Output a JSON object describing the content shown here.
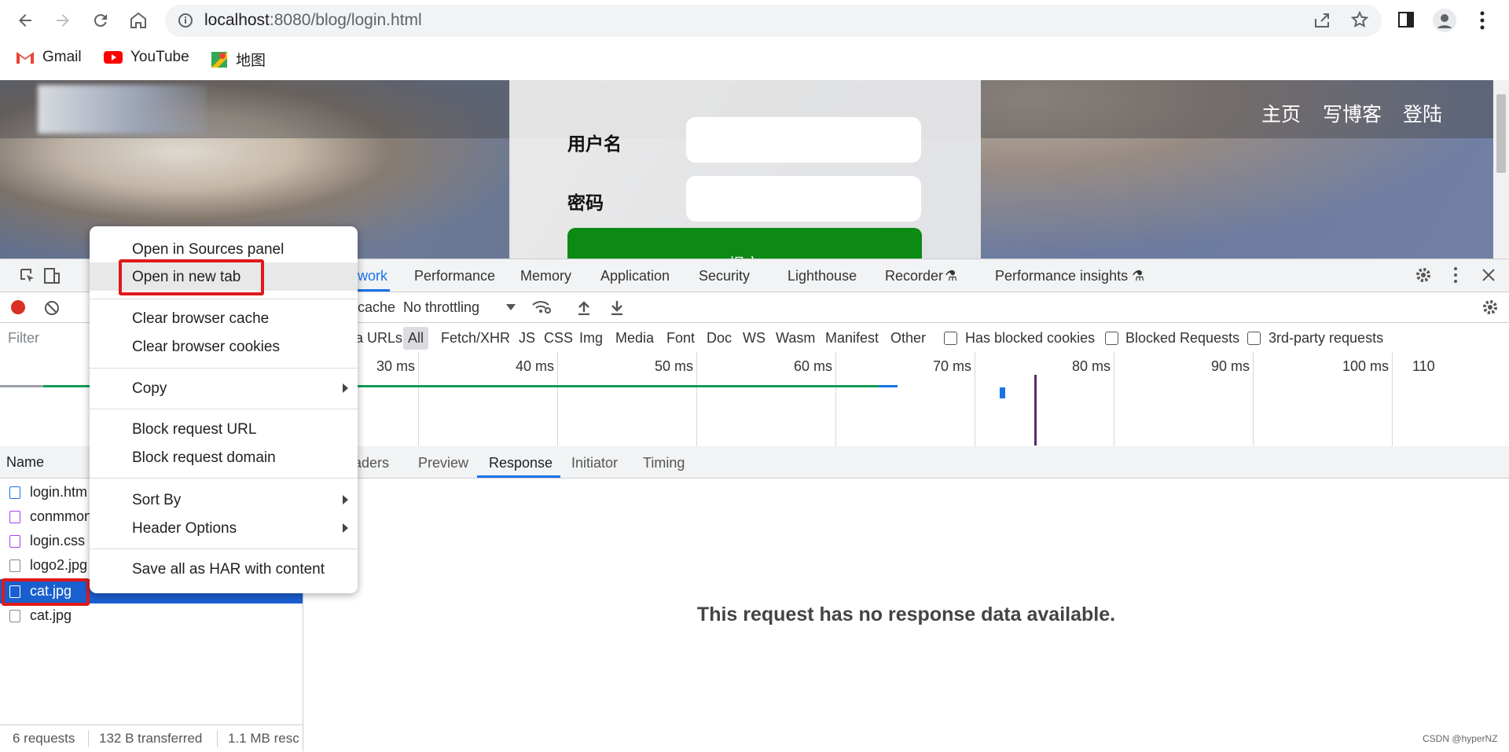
{
  "browser": {
    "url_host": "localhost",
    "url_path": ":8080/blog/login.html",
    "bookmarks": [
      {
        "label": "Gmail",
        "icon": "gmail-icon"
      },
      {
        "label": "YouTube",
        "icon": "youtube-icon"
      },
      {
        "label": "地图",
        "icon": "maps-icon"
      }
    ]
  },
  "page": {
    "nav": [
      "主页",
      "写博客",
      "登陆"
    ],
    "username_label": "用户名",
    "password_label": "密码",
    "submit_label": "提交"
  },
  "devtools": {
    "tabs": [
      "work",
      "Performance",
      "Memory",
      "Application",
      "Security",
      "Lighthouse",
      "Recorder",
      "Performance insights"
    ],
    "toolbar": {
      "cache_text": "cache",
      "throttling": "No throttling"
    },
    "filter_placeholder": "Filter",
    "filter_types": [
      "a URLs",
      "All",
      "Fetch/XHR",
      "JS",
      "CSS",
      "Img",
      "Media",
      "Font",
      "Doc",
      "WS",
      "Wasm",
      "Manifest",
      "Other"
    ],
    "checkboxes": [
      "Has blocked cookies",
      "Blocked Requests",
      "3rd-party requests"
    ],
    "timeline_ticks": [
      "30 ms",
      "40 ms",
      "50 ms",
      "60 ms",
      "70 ms",
      "80 ms",
      "90 ms",
      "100 ms",
      "110"
    ],
    "name_header": "Name",
    "requests": [
      {
        "name": "login.htm",
        "type": "doc"
      },
      {
        "name": "conmmon",
        "type": "css"
      },
      {
        "name": "login.css",
        "type": "css"
      },
      {
        "name": "logo2.jpg",
        "type": "img"
      },
      {
        "name": "cat.jpg",
        "type": "img",
        "selected": true
      },
      {
        "name": "cat.jpg",
        "type": "img"
      }
    ],
    "detail_tabs": [
      "eaders",
      "Preview",
      "Response",
      "Initiator",
      "Timing"
    ],
    "active_detail_tab": "Response",
    "no_response_message": "This request has no response data available.",
    "status": {
      "requests": "6 requests",
      "transferred": "132 B transferred",
      "resources": "1.1 MB resc"
    }
  },
  "context_menu": {
    "items": [
      {
        "label": "Open in Sources panel"
      },
      {
        "label": "Open in new tab",
        "highlighted": true
      },
      {
        "label": "Clear browser cache"
      },
      {
        "label": "Clear browser cookies"
      },
      {
        "label": "Copy",
        "submenu": true
      },
      {
        "label": "Block request URL"
      },
      {
        "label": "Block request domain"
      },
      {
        "label": "Sort By",
        "submenu": true
      },
      {
        "label": "Header Options",
        "submenu": true
      },
      {
        "label": "Save all as HAR with content"
      }
    ]
  },
  "watermark": "CSDN @hyperNZ",
  "colors": {
    "accent_blue": "#1a73e8",
    "record_red": "#d93025",
    "highlight_red": "#e0191a",
    "submit_green": "#0c8a14",
    "selected_row": "#1a5fd0"
  }
}
